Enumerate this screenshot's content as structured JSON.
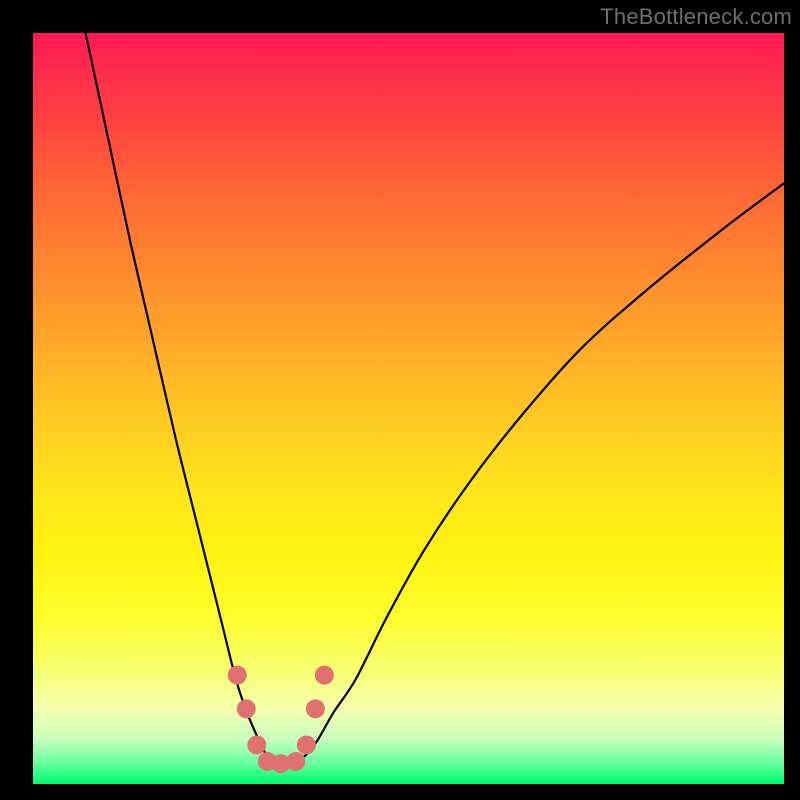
{
  "watermark": "TheBottleneck.com",
  "chart_data": {
    "type": "line",
    "title": "",
    "xlabel": "",
    "ylabel": "",
    "xlim": [
      0,
      100
    ],
    "ylim": [
      0,
      100
    ],
    "grid": false,
    "series": [
      {
        "name": "bottleneck-curve",
        "x": [
          7,
          10,
          13,
          16,
          19,
          22,
          25,
          27,
          28.5,
          30,
          31,
          32,
          33,
          34,
          35,
          36.5,
          38,
          40,
          43,
          47,
          52,
          58,
          65,
          73,
          82,
          92,
          100
        ],
        "values": [
          100,
          86,
          72,
          59,
          46,
          34,
          22,
          14,
          9.5,
          6,
          4,
          3,
          2.7,
          2.7,
          3,
          4,
          6,
          9.5,
          14,
          22,
          31,
          40,
          49,
          58,
          66,
          74,
          80
        ]
      }
    ],
    "markers": {
      "name": "highlighted-points",
      "x": [
        27.2,
        28.4,
        29.8,
        31.2,
        33.0,
        35.0,
        36.4,
        37.6,
        38.8
      ],
      "values": [
        14.5,
        10.0,
        5.2,
        3.0,
        2.7,
        3.0,
        5.2,
        10.0,
        14.5
      ]
    },
    "colors": {
      "curve": "#000000",
      "marker": "#e17070",
      "gradient_top": "#ff1a52",
      "gradient_mid": "#ffe31c",
      "gradient_bottom": "#00fd6f"
    }
  }
}
